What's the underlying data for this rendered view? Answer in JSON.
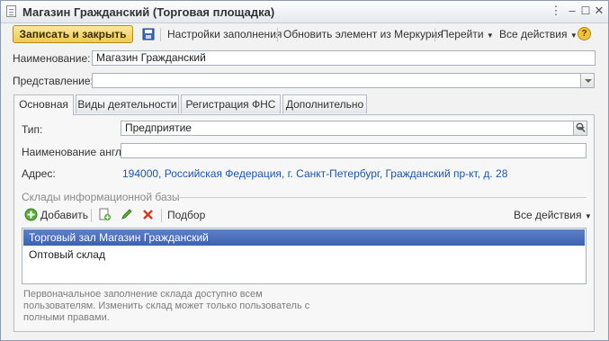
{
  "window": {
    "title": "Магазин Гражданский (Торговая площадка)"
  },
  "toolbar": {
    "save_close": "Записать и закрыть",
    "settings": "Настройки заполнения",
    "update_mercury": "Обновить элемент из Меркурия",
    "goto": "Перейти",
    "all_actions": "Все действия"
  },
  "form": {
    "name_label": "Наименование:",
    "name_value": "Магазин Гражданский",
    "repr_label": "Представление:",
    "repr_value": ""
  },
  "tabs": [
    "Основная",
    "Виды деятельности",
    "Регистрация ФНС",
    "Дополнительно"
  ],
  "main": {
    "type_label": "Тип:",
    "type_value": "Предприятие",
    "name_en_label": "Наименование англ:",
    "name_en_value": "",
    "address_label": "Адрес:",
    "address_value": "194000, Российская Федерация, г. Санкт-Петербург, Гражданский пр-кт, д. 28"
  },
  "warehouses": {
    "group_title": "Склады информационной базы",
    "add": "Добавить",
    "pick": "Подбор",
    "all_actions": "Все действия",
    "items": [
      "Торговый зал Магазин Гражданский",
      "Оптовый склад"
    ],
    "note": "Первоначальное заполнение склада доступно всем пользователям. Изменить склад может только пользователь с полными правами."
  },
  "icons": [
    "doc-icon",
    "save-icon",
    "dropdown-arrow-icon",
    "search-icon",
    "add-icon",
    "copy-icon",
    "edit-icon",
    "delete-icon",
    "help-icon"
  ]
}
